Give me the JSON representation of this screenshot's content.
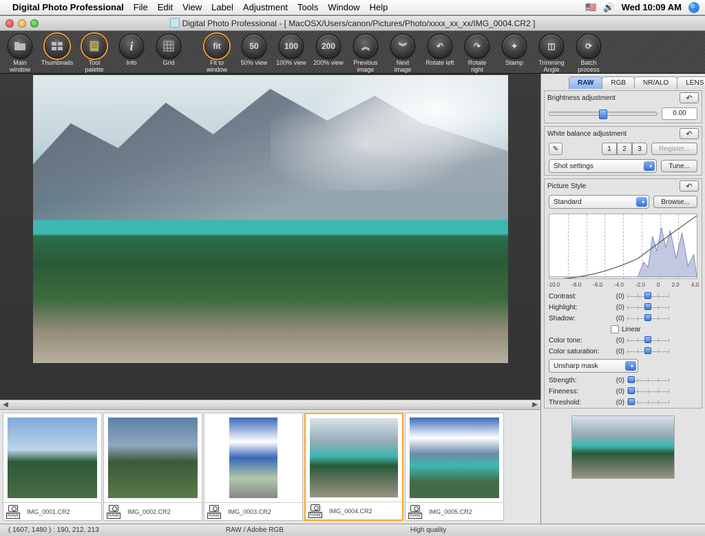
{
  "menubar": {
    "app_name": "Digital Photo Professional",
    "items": [
      "File",
      "Edit",
      "View",
      "Label",
      "Adjustment",
      "Tools",
      "Window",
      "Help"
    ],
    "clock": "Wed 10:09 AM"
  },
  "window": {
    "title": "Digital Photo Professional - [ MacOSX/Users/canon/Pictures/Photo/xxxx_xx_xx/IMG_0004.CR2 ]"
  },
  "toolbar": [
    {
      "icon": "folder",
      "label": "Main\nwindow"
    },
    {
      "icon": "thumbs",
      "label": "Thumbnails",
      "sel": true
    },
    {
      "icon": "palette",
      "label": "Tool\npalette",
      "sel": true
    },
    {
      "icon": "info",
      "label": "Info"
    },
    {
      "icon": "grid",
      "label": "Grid"
    },
    {
      "icon": "fit",
      "label": "Fit to\nwindow",
      "sel": true,
      "txt": "fit"
    },
    {
      "icon": "50",
      "label": "50% view",
      "txt": "50"
    },
    {
      "icon": "100",
      "label": "100% view",
      "txt": "100"
    },
    {
      "icon": "200",
      "label": "200% view",
      "txt": "200"
    },
    {
      "icon": "prev",
      "label": "Previous\nimage",
      "txt": "︽"
    },
    {
      "icon": "next",
      "label": "Next\nimage",
      "txt": "︾"
    },
    {
      "icon": "rotl",
      "label": "Rotate left",
      "txt": "↶"
    },
    {
      "icon": "rotr",
      "label": "Rotate right",
      "txt": "↷"
    },
    {
      "icon": "stamp",
      "label": "Stamp",
      "txt": "✦"
    },
    {
      "icon": "trim",
      "label": "Trimming\nAngle",
      "txt": "◫"
    },
    {
      "icon": "batch",
      "label": "Batch\nprocess",
      "txt": "⟳"
    }
  ],
  "panel": {
    "tabs": [
      "RAW",
      "RGB",
      "NR/ALO",
      "LENS"
    ],
    "active_tab": 0,
    "brightness": {
      "label": "Brightness adjustment",
      "value": "0.00"
    },
    "wb": {
      "label": "White balance adjustment",
      "presets": [
        "1",
        "2",
        "3"
      ],
      "register": "Register...",
      "dropdown": "Shot settings",
      "tune": "Tune..."
    },
    "picstyle": {
      "label": "Picture Style",
      "dropdown": "Standard",
      "browse": "Browse...",
      "axis": [
        "-10.0",
        "-8.0",
        "-6.0",
        "-4.0",
        "-2.0",
        "0",
        "2.0",
        "4.0"
      ],
      "adjustments": [
        {
          "name": "Contrast:",
          "val": "(0)",
          "pos": 50
        },
        {
          "name": "Highlight:",
          "val": "(0)",
          "pos": 50
        },
        {
          "name": "Shadow:",
          "val": "(0)",
          "pos": 50
        }
      ],
      "linear": "Linear",
      "adjustments2": [
        {
          "name": "Color tone:",
          "val": "(0)",
          "pos": 50
        },
        {
          "name": "Color saturation:",
          "val": "(0)",
          "pos": 50
        }
      ],
      "sharp_dropdown": "Unsharp mask",
      "sharp": [
        {
          "name": "Strength:",
          "val": "(0)",
          "pos": 10
        },
        {
          "name": "Fineness:",
          "val": "(0)",
          "pos": 10
        },
        {
          "name": "Threshold:",
          "val": "(0)",
          "pos": 10
        }
      ]
    }
  },
  "thumbnails": [
    {
      "file": "IMG_0001.CR2",
      "bg": "linear-gradient(#7fa9d8 0%,#bcd4e8 40%,#2d5a3a 55%,#4a6b44 100%)"
    },
    {
      "file": "IMG_0002.CR2",
      "bg": "linear-gradient(#5b7fa8 0%,#8ea8bb 35%,#3a5a3a 55%,#5a7a4a 100%)"
    },
    {
      "file": "IMG_0003.CR2",
      "bg": "linear-gradient(#3a67b8 0%,#ffffff 30%,#3a67b8 50%,#b0c8aa 75%,#888 100%)",
      "portrait": true
    },
    {
      "file": "IMG_0004.CR2",
      "bg": "linear-gradient(#d8e4ea 0%,#94aab5 30%,#3db8b0 48%,#2a5938 60%,#9c9484 100%)",
      "sel": true
    },
    {
      "file": "IMG_0005.CR2",
      "bg": "linear-gradient(#3a6bb8 0%,#ffffff 25%,#6a8aa8 45%,#3db8b0 60%,#446a4a 80%)"
    }
  ],
  "status": {
    "coords": "( 1607, 1480 ) : 190, 212, 213",
    "colorspace": "RAW / Adobe RGB",
    "quality": "High quality"
  },
  "raw_badge": "RAW"
}
